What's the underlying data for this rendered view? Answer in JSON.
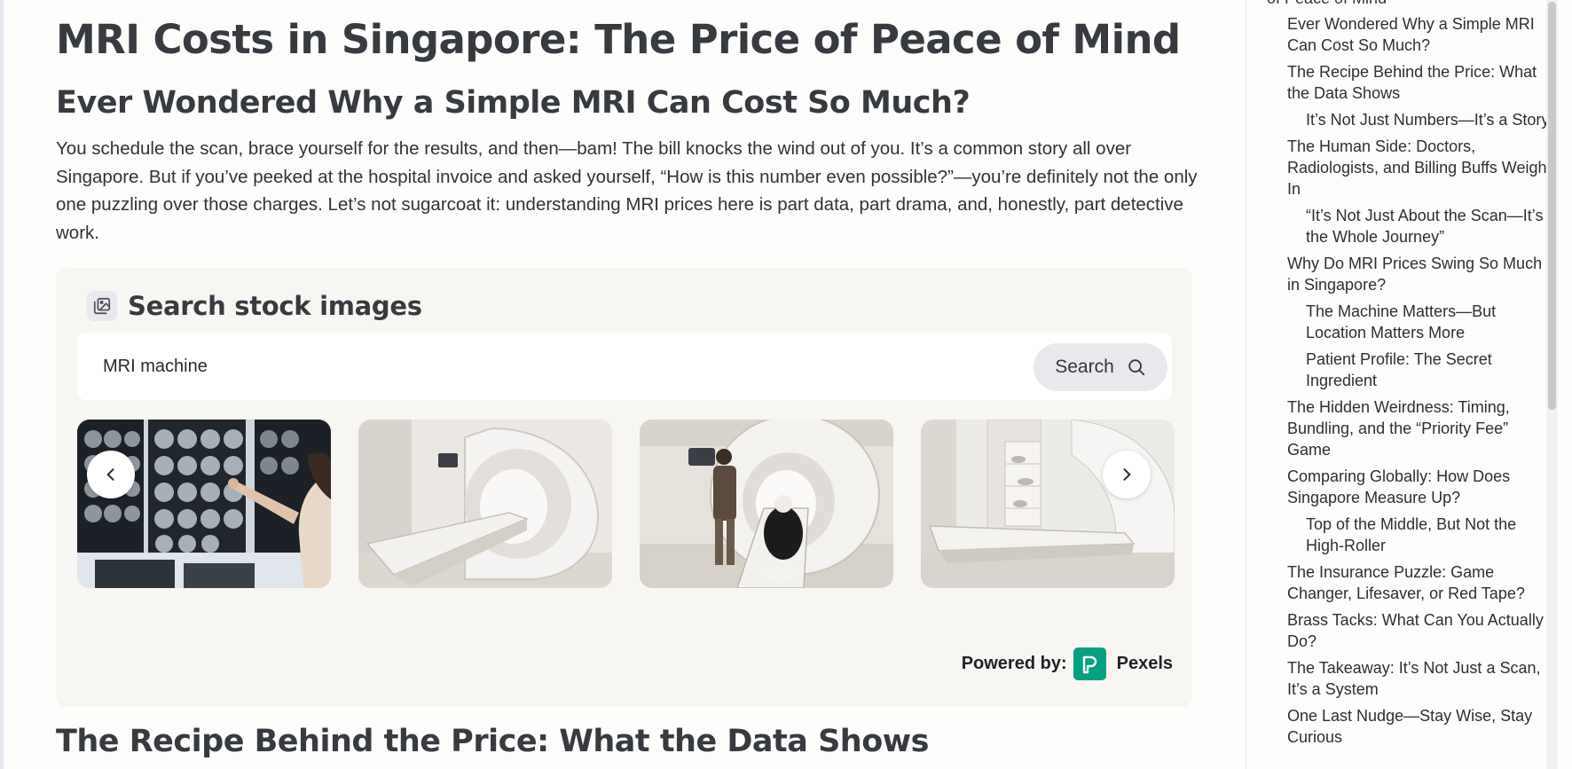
{
  "article": {
    "title": "MRI Costs in Singapore: The Price of Peace of Mind",
    "section_heading": "Ever Wondered Why a Simple MRI Can Cost So Much?",
    "intro": " You schedule the scan, brace yourself for the results, and then—bam! The bill knocks the wind out of you. It’s a common story all over Singapore. But if you’ve peeked at the hospital invoice and asked yourself, “How is this number even possible?”—you’re definitely not the only one puzzling over those charges. Let’s not sugarcoat it: understanding MRI prices here is part data, part drama, and, honestly, part detective work.",
    "next_heading": "The Recipe Behind the Price: What the Data Shows"
  },
  "stock_search": {
    "title": "Search stock images",
    "query": "MRI machine",
    "button_label": "Search",
    "powered_by_label": "Powered by:",
    "provider": "Pexels"
  },
  "toc": {
    "top_partial": "of Peace of Mind",
    "items": [
      {
        "label": "Ever Wondered Why a Simple MRI Can Cost So Much?",
        "sub": false
      },
      {
        "label": "The Recipe Behind the Price: What the Data Shows",
        "sub": false
      },
      {
        "label": "It’s Not Just Numbers—It’s a Story",
        "sub": true
      },
      {
        "label": "The Human Side: Doctors, Radiologists, and Billing Buffs Weigh In",
        "sub": false
      },
      {
        "label": "“It’s Not Just About the Scan—It’s the Whole Journey”",
        "sub": true
      },
      {
        "label": "Why Do MRI Prices Swing So Much in Singapore?",
        "sub": false
      },
      {
        "label": "The Machine Matters—But Location Matters More",
        "sub": true
      },
      {
        "label": "Patient Profile: The Secret Ingredient",
        "sub": true
      },
      {
        "label": "The Hidden Weirdness: Timing, Bundling, and the “Priority Fee” Game",
        "sub": false
      },
      {
        "label": "Comparing Globally: How Does Singapore Measure Up?",
        "sub": false
      },
      {
        "label": "Top of the Middle, But Not the High-Roller",
        "sub": true
      },
      {
        "label": "The Insurance Puzzle: Game Changer, Lifesaver, or Red Tape?",
        "sub": false
      },
      {
        "label": "Brass Tacks: What Can You Actually Do?",
        "sub": false
      },
      {
        "label": "The Takeaway: It’s Not Just a Scan, It’s a System",
        "sub": false
      },
      {
        "label": "One Last Nudge—Stay Wise, Stay Curious",
        "sub": false
      }
    ]
  },
  "icons": {
    "image_search": "image-gallery-icon",
    "search": "magnifier-icon",
    "prev": "chevron-left-icon",
    "next": "chevron-right-icon",
    "provider_logo": "pexels-logo"
  },
  "colors": {
    "pexels_brand": "#05a081",
    "widget_bg": "#f8f6f2",
    "heading": "#373b40"
  }
}
